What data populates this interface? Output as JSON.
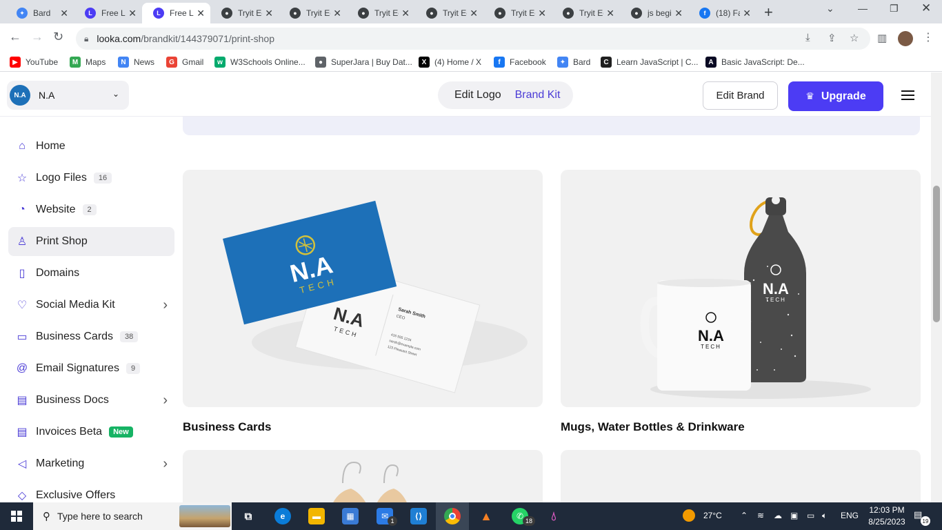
{
  "browser": {
    "tabs": [
      {
        "title": "Bard",
        "color": "#4285f4",
        "glyph": "✦"
      },
      {
        "title": "Free Lo",
        "color": "#4c3cf4",
        "glyph": "L"
      },
      {
        "title": "Free Lo",
        "color": "#4c3cf4",
        "glyph": "L"
      },
      {
        "title": "Tryit Ec",
        "color": "#3c4043",
        "glyph": "●"
      },
      {
        "title": "Tryit Ec",
        "color": "#3c4043",
        "glyph": "●"
      },
      {
        "title": "Tryit Ec",
        "color": "#3c4043",
        "glyph": "●"
      },
      {
        "title": "Tryit Ec",
        "color": "#3c4043",
        "glyph": "●"
      },
      {
        "title": "Tryit Ec",
        "color": "#3c4043",
        "glyph": "●"
      },
      {
        "title": "Tryit Ec",
        "color": "#3c4043",
        "glyph": "●"
      },
      {
        "title": "js begi",
        "color": "#3c4043",
        "glyph": "●"
      },
      {
        "title": "(18) Fa",
        "color": "#1877f2",
        "glyph": "f"
      }
    ],
    "active_tab_index": 2,
    "url_host": "looka.com",
    "url_path": "/brandkit/144379071/print-shop",
    "bookmarks": [
      {
        "label": "YouTube",
        "icon": "youtube-icon",
        "color": "#ff0000",
        "glyph": "▶"
      },
      {
        "label": "Maps",
        "icon": "maps-icon",
        "color": "#34a853",
        "glyph": "M"
      },
      {
        "label": "News",
        "icon": "news-icon",
        "color": "#4285f4",
        "glyph": "N"
      },
      {
        "label": "Gmail",
        "icon": "gmail-icon",
        "color": "#ea4335",
        "glyph": "G"
      },
      {
        "label": "W3Schools Online...",
        "icon": "w3schools-icon",
        "color": "#04aa6d",
        "glyph": "w"
      },
      {
        "label": "SuperJara | Buy Dat...",
        "icon": "globe-icon",
        "color": "#5f6368",
        "glyph": "●"
      },
      {
        "label": "(4) Home / X",
        "icon": "x-icon",
        "color": "#000000",
        "glyph": "X"
      },
      {
        "label": "Facebook",
        "icon": "facebook-icon",
        "color": "#1877f2",
        "glyph": "f"
      },
      {
        "label": "Bard",
        "icon": "bard-icon",
        "color": "#4285f4",
        "glyph": "✦"
      },
      {
        "label": "Learn JavaScript | C...",
        "icon": "codecademy-icon",
        "color": "#1f1f1f",
        "glyph": "C"
      },
      {
        "label": "Basic JavaScript: De...",
        "icon": "freecodecamp-icon",
        "color": "#0a0a23",
        "glyph": "A"
      }
    ]
  },
  "header": {
    "brand_initials": "N.A",
    "brand_name": "N.A",
    "seg_edit_logo": "Edit Logo",
    "seg_brand_kit": "Brand Kit",
    "edit_brand": "Edit Brand",
    "upgrade": "Upgrade"
  },
  "sidebar": {
    "items": [
      {
        "label": "Home",
        "icon": "home-icon",
        "glyph": "⌂",
        "count": "",
        "badge": "",
        "chevron": false,
        "active": false
      },
      {
        "label": "Logo Files",
        "icon": "star-icon",
        "glyph": "☆",
        "count": "16",
        "badge": "",
        "chevron": false,
        "active": false
      },
      {
        "label": "Website",
        "icon": "website-icon",
        "glyph": "◔",
        "count": "2",
        "badge": "",
        "chevron": false,
        "active": false
      },
      {
        "label": "Print Shop",
        "icon": "tshirt-icon",
        "glyph": "♙",
        "count": "",
        "badge": "",
        "chevron": false,
        "active": true
      },
      {
        "label": "Domains",
        "icon": "bookmark-icon",
        "glyph": "▯",
        "count": "",
        "badge": "",
        "chevron": false,
        "active": false
      },
      {
        "label": "Social Media Kit",
        "icon": "heart-icon",
        "glyph": "♡",
        "count": "",
        "badge": "",
        "chevron": true,
        "active": false
      },
      {
        "label": "Business Cards",
        "icon": "card-icon",
        "glyph": "▭",
        "count": "38",
        "badge": "",
        "chevron": false,
        "active": false
      },
      {
        "label": "Email Signatures",
        "icon": "at-icon",
        "glyph": "@",
        "count": "9",
        "badge": "",
        "chevron": false,
        "active": false
      },
      {
        "label": "Business Docs",
        "icon": "docs-icon",
        "glyph": "▤",
        "count": "",
        "badge": "",
        "chevron": true,
        "active": false
      },
      {
        "label": "Invoices Beta",
        "icon": "invoice-icon",
        "glyph": "▤",
        "count": "",
        "badge": "New",
        "chevron": false,
        "active": false
      },
      {
        "label": "Marketing",
        "icon": "megaphone-icon",
        "glyph": "◁",
        "count": "",
        "badge": "",
        "chevron": true,
        "active": false
      },
      {
        "label": "Exclusive Offers",
        "icon": "tag-icon",
        "glyph": "◇",
        "count": "",
        "badge": "",
        "chevron": false,
        "active": false
      }
    ]
  },
  "main": {
    "products": [
      {
        "title": "Business Cards"
      },
      {
        "title": "Mugs, Water Bottles & Drinkware"
      }
    ],
    "mockups": {
      "card_logo_main": "N.A",
      "card_logo_sub": "TECH",
      "card_name": "Sarah Smith",
      "card_role": "CEO",
      "card_phone": "416 555 1234",
      "card_email": "sarah@example.com",
      "card_address": "123 Pleasant Street",
      "mug_logo_main": "N.A",
      "mug_logo_sub": "TECH",
      "bottle_logo_main": "N.A",
      "bottle_logo_sub": "TECH"
    }
  },
  "taskbar": {
    "search_placeholder": "Type here to search",
    "weather": "27°C",
    "lang": "ENG",
    "time": "12:03 PM",
    "date": "8/25/2023",
    "notifications": "19",
    "mail_badge": "1",
    "whatsapp_badge": "18"
  },
  "colors": {
    "accent": "#4c3cf4",
    "brand_blue": "#1d70b8",
    "new_badge": "#16b364"
  }
}
